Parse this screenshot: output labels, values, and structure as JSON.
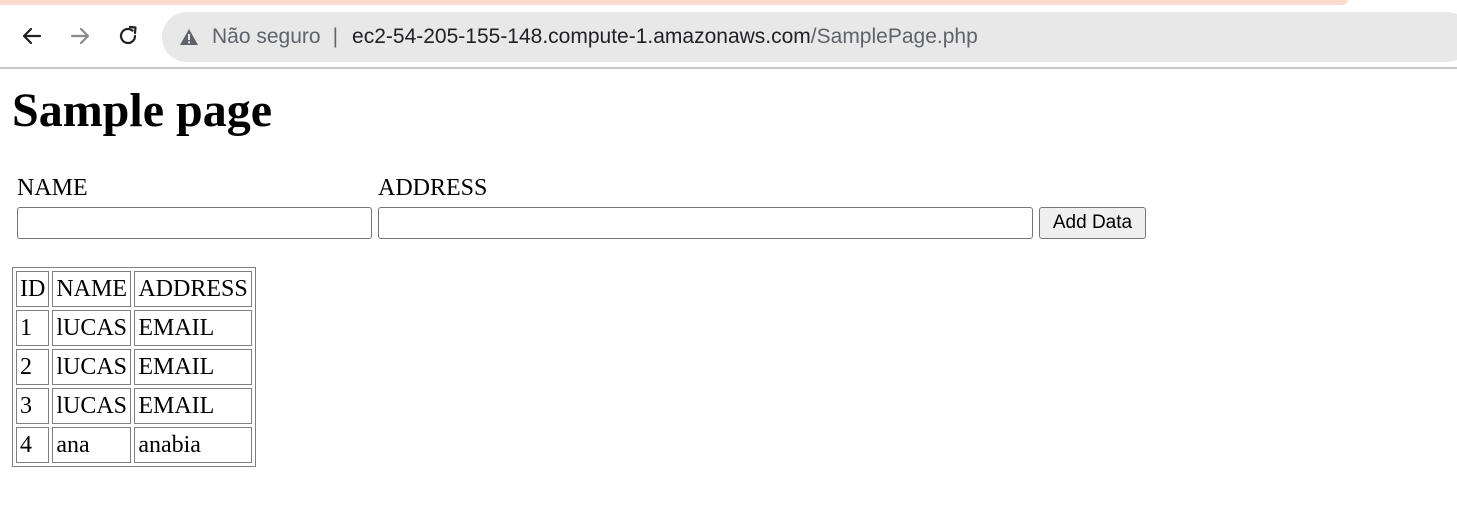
{
  "browser": {
    "security_label": "Não seguro",
    "url_separator": "|",
    "url_host": "ec2-54-205-155-148.compute-1.amazonaws.com",
    "url_path": "/SamplePage.php",
    "icons": {
      "back": "arrow-left-icon",
      "forward": "arrow-right-icon",
      "reload": "reload-icon",
      "security": "warning-triangle-icon"
    },
    "colors": {
      "omnibox_bg": "#e8e8e8",
      "tab_accent": "#fbdccc"
    }
  },
  "page": {
    "title": "Sample page",
    "form": {
      "name_label": "NAME",
      "address_label": "ADDRESS",
      "name_value": "",
      "address_value": "",
      "submit_label": "Add Data"
    },
    "table": {
      "headers": [
        "ID",
        "NAME",
        "ADDRESS"
      ],
      "rows": [
        [
          "1",
          "lUCAS",
          "EMAIL"
        ],
        [
          "2",
          "lUCAS",
          "EMAIL"
        ],
        [
          "3",
          "lUCAS",
          "EMAIL"
        ],
        [
          "4",
          "ana",
          "anabia"
        ]
      ]
    }
  }
}
